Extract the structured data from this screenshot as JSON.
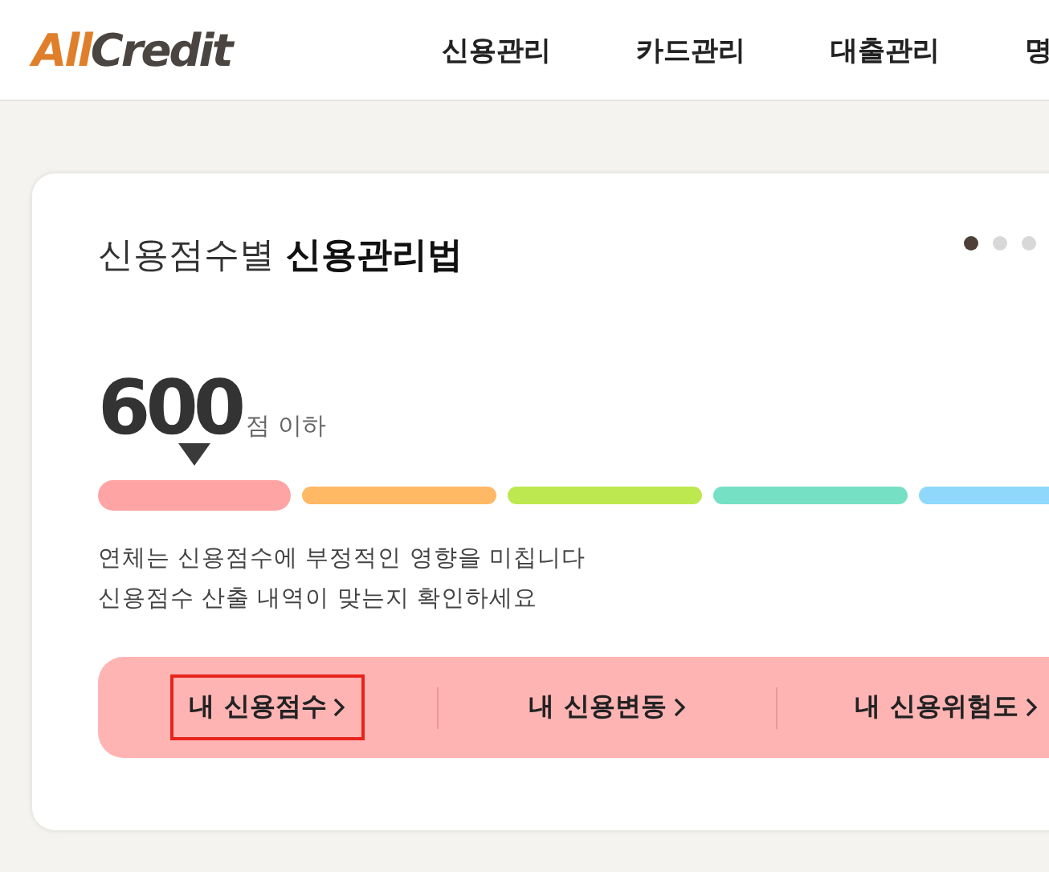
{
  "header": {
    "logo": {
      "accent": "All",
      "rest": "Credit"
    },
    "nav": [
      "신용관리",
      "카드관리",
      "대출관리",
      "명"
    ]
  },
  "card": {
    "title": {
      "light": "신용점수별",
      "bold": "신용관리법"
    },
    "pager": [
      {
        "selected": true
      },
      {
        "selected": false
      },
      {
        "selected": false
      }
    ],
    "score": {
      "value": "600",
      "unit": "점 이하"
    },
    "segments": [
      {
        "color": "#ffa4a4",
        "selected": true
      },
      {
        "color": "#ffb864",
        "selected": false
      },
      {
        "color": "#bde84f",
        "selected": false
      },
      {
        "color": "#76e0c4",
        "selected": false
      },
      {
        "color": "#90d8fb",
        "selected": false
      }
    ],
    "notes": [
      "연체는 신용점수에 부정적인 영향을 미칩니다",
      "신용점수 산출 내역이 맞는지 확인하세요"
    ],
    "links": [
      {
        "label": "내 신용점수",
        "highlighted": true
      },
      {
        "label": "내 신용변동",
        "highlighted": false
      },
      {
        "label": "내 신용위험도",
        "highlighted": false
      }
    ]
  }
}
